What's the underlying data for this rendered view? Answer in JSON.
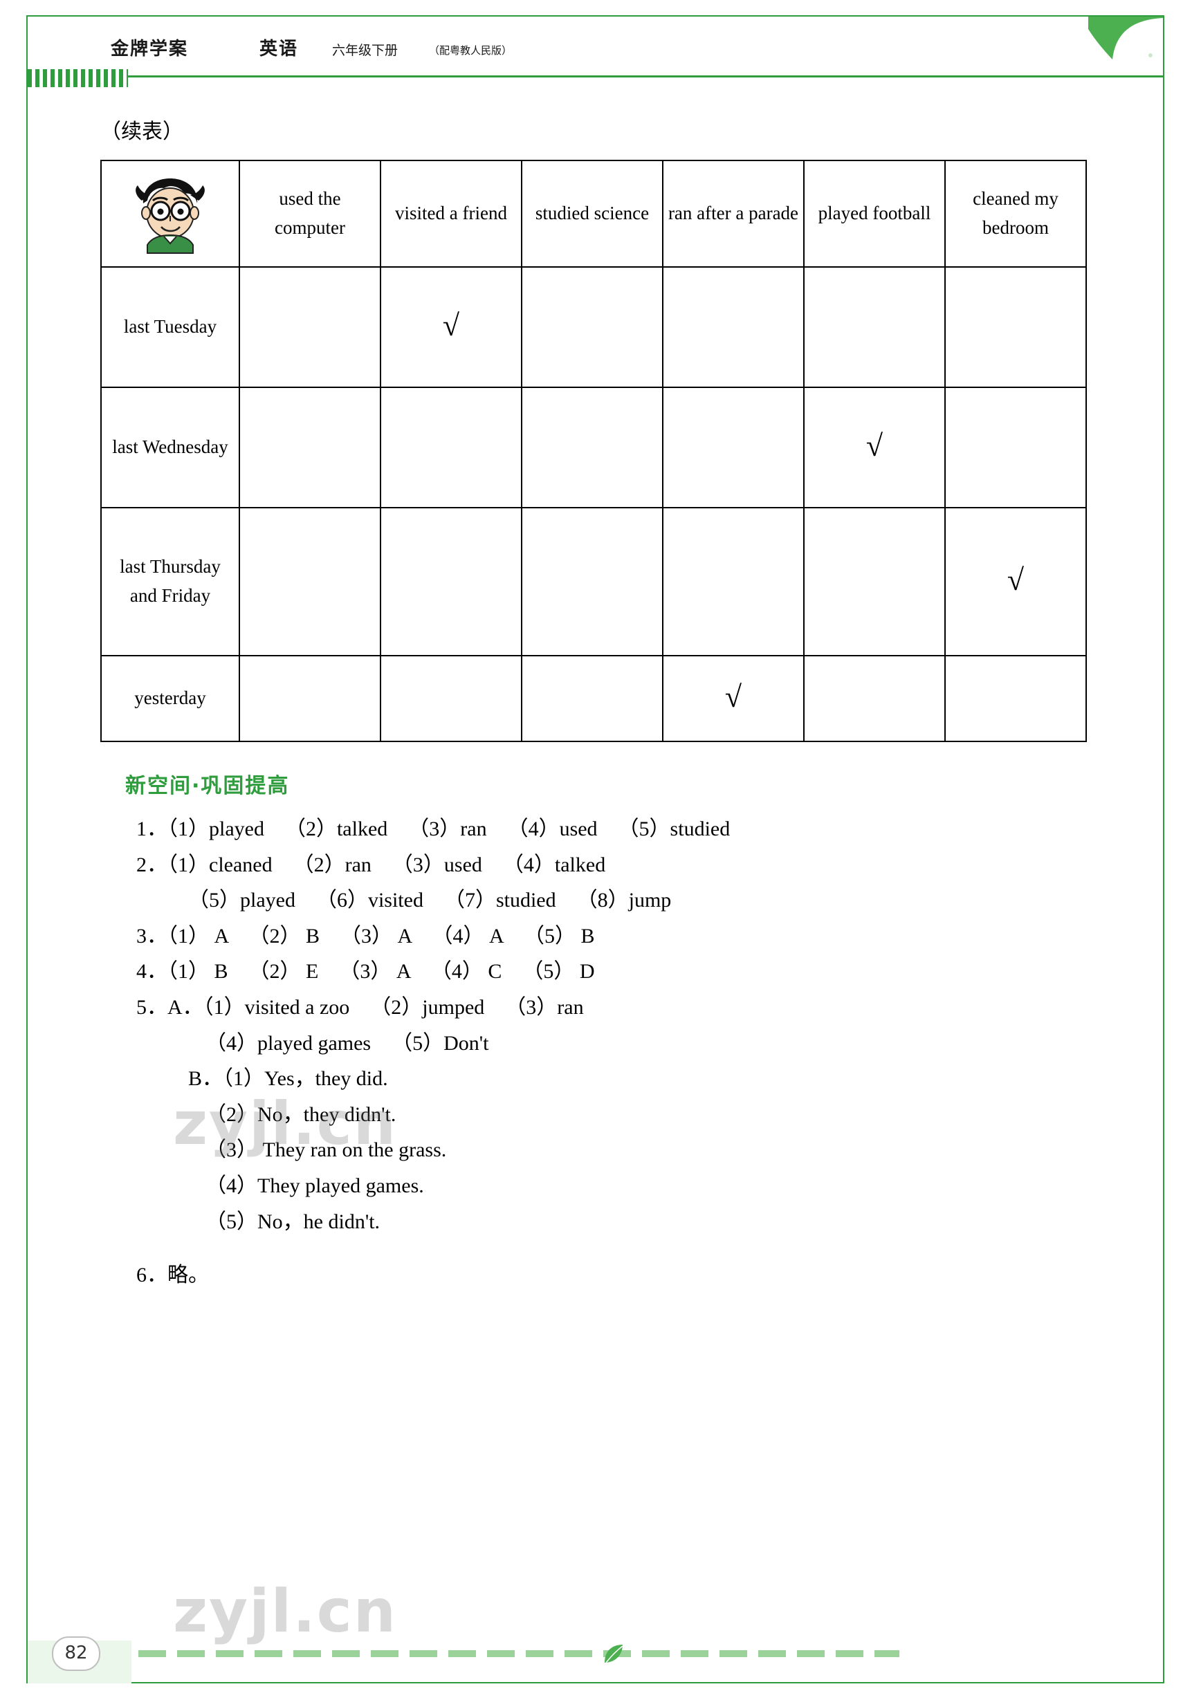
{
  "header": {
    "title": "金牌学案",
    "subject": "英语",
    "grade": "六年级下册",
    "edition": "（配粤教人民版）"
  },
  "content": {
    "continued_label": "（续表）",
    "table": {
      "avatar_alt": "boy-avatar",
      "columns": [
        "used the computer",
        "visited a friend",
        "studied science",
        "ran after a parade",
        "played football",
        "cleaned my bedroom"
      ],
      "rows": [
        {
          "label": "last Tuesday",
          "marks": [
            false,
            true,
            false,
            false,
            false,
            false
          ]
        },
        {
          "label": "last Wednesday",
          "marks": [
            false,
            false,
            false,
            false,
            true,
            false
          ]
        },
        {
          "label": "last Thursday and Friday",
          "marks": [
            false,
            false,
            false,
            false,
            false,
            true
          ]
        },
        {
          "label": "yesterday",
          "marks": [
            false,
            false,
            false,
            true,
            false,
            false
          ]
        }
      ],
      "tick_glyph": "√"
    },
    "section_heading": "新空间·巩固提高",
    "answers": [
      {
        "indent": 0,
        "text": "1．（1）played    （2）talked    （3）ran    （4）used    （5）studied"
      },
      {
        "indent": 0,
        "text": "2．（1）cleaned    （2）ran    （3）used    （4）talked"
      },
      {
        "indent": 1,
        "text": "（5）played    （6）visited    （7）studied    （8）jump"
      },
      {
        "indent": 0,
        "text": "3．（1） A    （2） B    （3） A    （4） A    （5） B"
      },
      {
        "indent": 0,
        "text": "4．（1） B    （2） E    （3） A    （4） C    （5） D"
      },
      {
        "indent": 0,
        "text": "5．A．（1）visited a zoo    （2）jumped    （3）ran"
      },
      {
        "indent": 2,
        "text": "（4）played games    （5）Don't"
      },
      {
        "indent": 1,
        "text": "B．（1）Yes，they did."
      },
      {
        "indent": 2,
        "text": "（2）No，they didn't."
      },
      {
        "indent": 2,
        "text": "（3） They ran on the grass."
      },
      {
        "indent": 2,
        "text": "（4）They played games."
      },
      {
        "indent": 2,
        "text": "（5）No，he didn't."
      },
      {
        "indent": 0,
        "text": "6．略。"
      }
    ]
  },
  "footer": {
    "page_number": "82"
  },
  "watermark": {
    "text1": "zyjl.cn",
    "text2": "zyjl.cn"
  },
  "colors": {
    "accent_green": "#2f9d3e",
    "heading_green": "#2f9d3e"
  }
}
